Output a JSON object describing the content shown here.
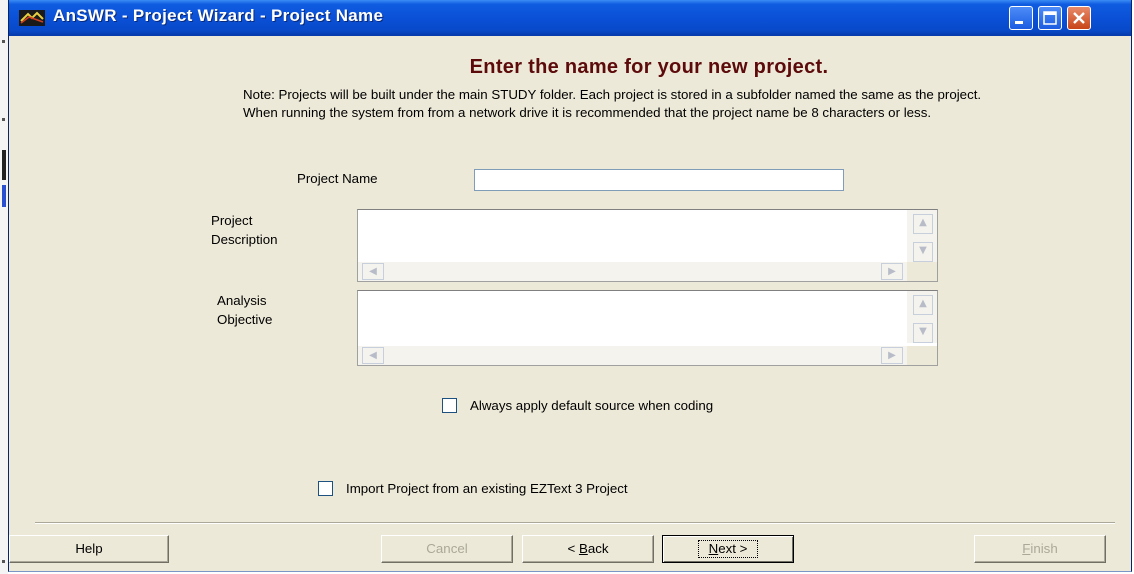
{
  "window": {
    "title": "AnSWR - Project Wizard - Project Name"
  },
  "heading": "Enter the name for your new project.",
  "note": "Note: Projects will be built under the main STUDY folder. Each project is stored in a subfolder named the same as the project. When running the system from from a network drive it is recommended that the project name be 8 characters or less.",
  "form": {
    "project_name_label": "Project Name",
    "project_name_value": "",
    "description_label": "Project\nDescription",
    "description_value": "",
    "objective_label": "Analysis\nObjective",
    "objective_value": "",
    "default_source_label": "Always apply default source when coding",
    "default_source_checked": false,
    "import_label": "Import Project from an existing EZText 3 Project",
    "import_checked": false
  },
  "buttons": {
    "help": "Help",
    "cancel": "Cancel",
    "back_prefix": "< ",
    "back_key": "B",
    "back_rest": "ack",
    "next_key": "N",
    "next_rest": "ext >",
    "finish_key": "F",
    "finish_rest": "inish"
  }
}
